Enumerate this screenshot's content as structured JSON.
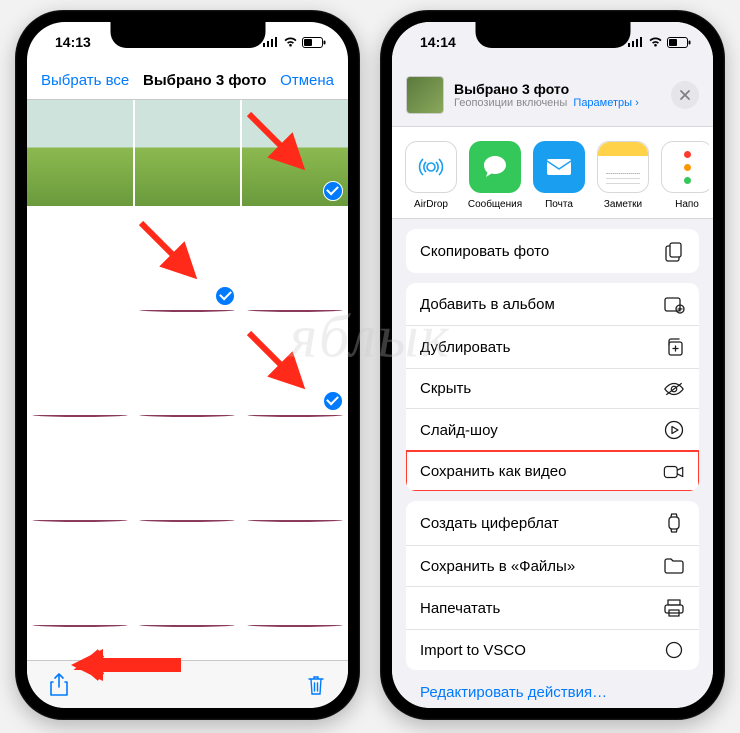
{
  "left": {
    "status": {
      "time": "14:13"
    },
    "navbar": {
      "select_all": "Выбрать все",
      "title": "Выбрано 3 фото",
      "cancel": "Отмена"
    },
    "photos": [
      {
        "kind": "field",
        "selected": false
      },
      {
        "kind": "field",
        "selected": false
      },
      {
        "kind": "field",
        "selected": true
      },
      {
        "kind": "waterfall",
        "selected": false
      },
      {
        "kind": "waterfall",
        "selected": true
      },
      {
        "kind": "waterfall",
        "selected": false
      },
      {
        "kind": "waterfall",
        "selected": false
      },
      {
        "kind": "wheel",
        "selected": false
      },
      {
        "kind": "wheel",
        "selected": true
      },
      {
        "kind": "wheel",
        "selected": false
      },
      {
        "kind": "wheel",
        "selected": false
      },
      {
        "kind": "wheel",
        "selected": false
      },
      {
        "kind": "wheel",
        "selected": false
      },
      {
        "kind": "wheel",
        "selected": false
      },
      {
        "kind": "wheel",
        "selected": false
      }
    ]
  },
  "right": {
    "status": {
      "time": "14:14"
    },
    "sheet": {
      "title": "Выбрано 3 фото",
      "subtitle_prefix": "Геопозиции включены",
      "options_link": "Параметры",
      "apps": [
        {
          "name": "AirDrop",
          "label": "AirDrop",
          "bg": "#ffffff",
          "border": true,
          "icon": "airdrop"
        },
        {
          "name": "Messages",
          "label": "Сообщения",
          "bg": "#34c759",
          "icon": "bubble"
        },
        {
          "name": "Mail",
          "label": "Почта",
          "bg": "#1a9ff0",
          "icon": "envelope"
        },
        {
          "name": "Notes",
          "label": "Заметки",
          "bg": "#ffffff",
          "border": true,
          "icon": "notes"
        },
        {
          "name": "Other",
          "label": "Напо",
          "bg": "#ffffff",
          "border": true,
          "icon": "dots"
        }
      ],
      "actions": [
        {
          "label": "Скопировать фото",
          "icon": "copy"
        },
        {
          "label": "Добавить в альбом",
          "icon": "album"
        },
        {
          "label": "Дублировать",
          "icon": "duplicate"
        },
        {
          "label": "Скрыть",
          "icon": "hide"
        },
        {
          "label": "Слайд-шоу",
          "icon": "play"
        },
        {
          "label": "Сохранить как видео",
          "icon": "video",
          "highlight": true
        },
        {
          "label": "Создать циферблат",
          "icon": "watch"
        },
        {
          "label": "Сохранить в «Файлы»",
          "icon": "folder"
        },
        {
          "label": "Напечатать",
          "icon": "print"
        },
        {
          "label": "Import to VSCO",
          "icon": "circle"
        }
      ],
      "edit": "Редактировать действия…"
    }
  },
  "watermark": "яблык"
}
